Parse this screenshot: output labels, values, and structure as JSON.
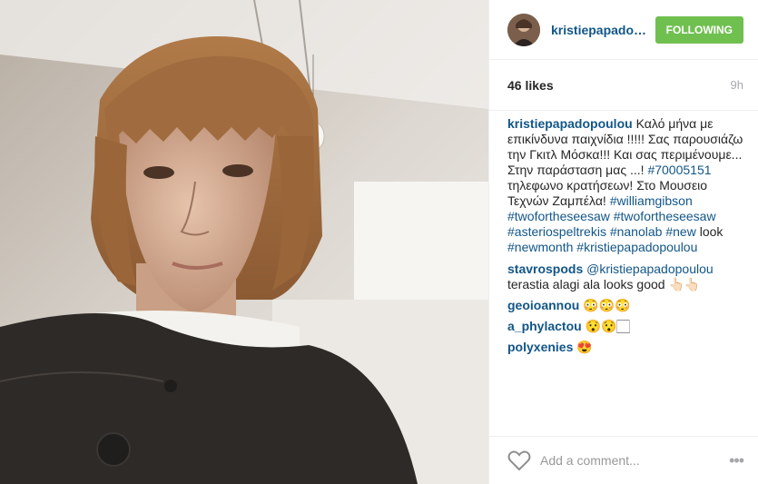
{
  "header": {
    "username": "kristiepapadop...",
    "follow_label": "FOLLOWING"
  },
  "stats": {
    "likes": "46 likes",
    "time": "9h"
  },
  "caption": {
    "user": "kristiepapadopoulou",
    "text1": " Καλό μήνα με επικίνδυνα παιχνίδια !!!!! Σας παρουσιάζω την Γκιτλ Μόσκα!!! Και σας περιμένουμε... Στην παράσταση μας ...! ",
    "link_phone": "#70005151",
    "text2": " τηλεφωνο κρατήσεων! Στο Μουσειο Τεχνών Ζαμπέλα! ",
    "tag1": "#williamgibson",
    "tag2": "#twofortheseesaw",
    "tag3": "#twofortheseesaw",
    "tag4": "#asteriospeltrekis",
    "tag5": "#nanolab",
    "tag6": "#new",
    "text3": " look ",
    "tag7": "#newmonth",
    "tag8": "#kristiepapadopoulou"
  },
  "comments": [
    {
      "user": "stavrospods",
      "mention": "@kristiepapadopoulou",
      "text": " terastia alagi ala looks good 👆🏻👆🏻"
    },
    {
      "user": "geoioannou",
      "text": " 😳😳😳"
    },
    {
      "user": "a_phylactou",
      "text": " 😯😯🏻"
    },
    {
      "user": "polyxenies",
      "text": " 😍"
    }
  ],
  "footer": {
    "placeholder": "Add a comment...",
    "more": "•••"
  },
  "icons": {
    "like": "heart-icon",
    "more": "more-options-icon"
  }
}
